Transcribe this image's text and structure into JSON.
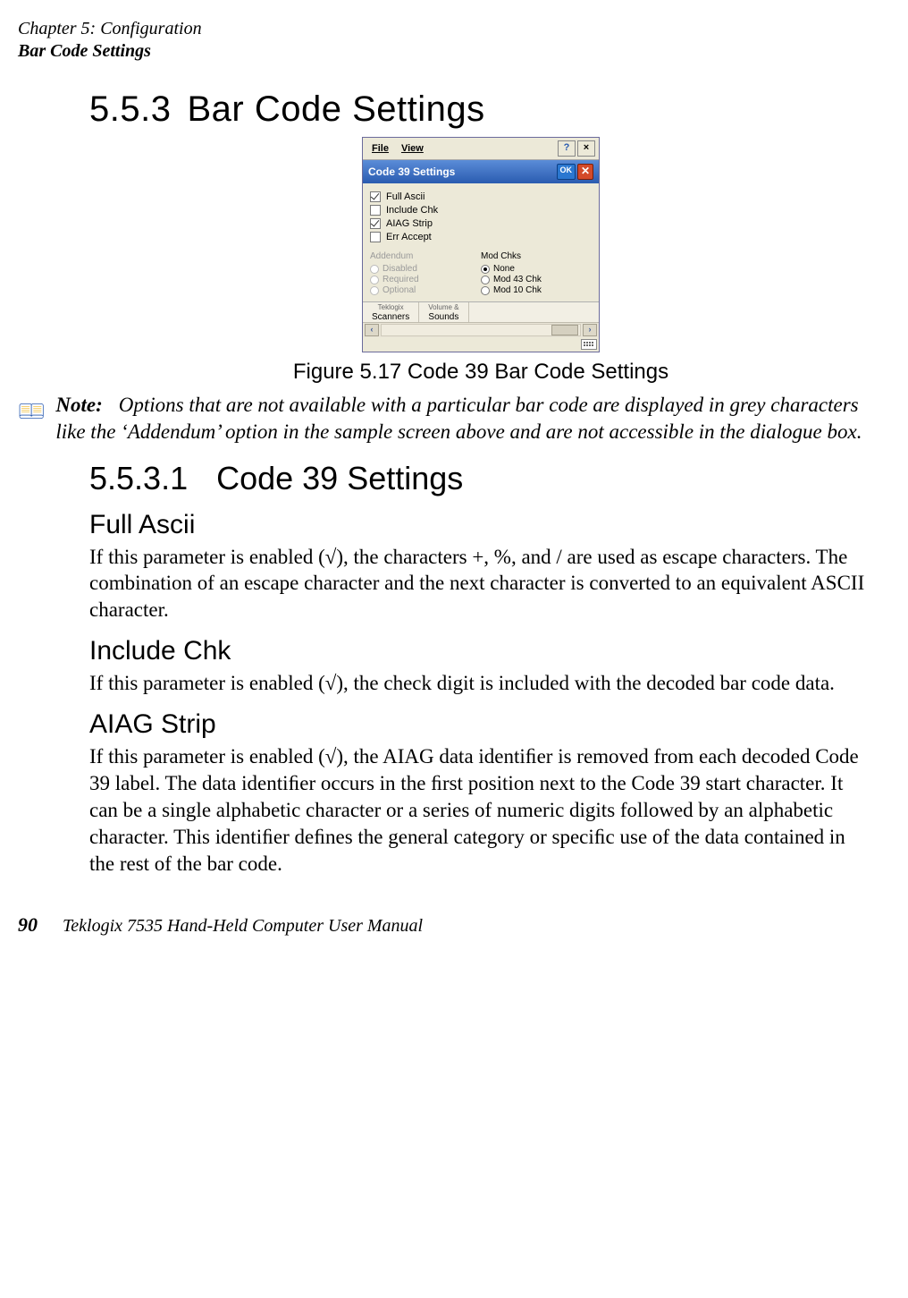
{
  "header": {
    "line1": "Chapter 5: Configuration",
    "line2": "Bar Code Settings"
  },
  "section": {
    "number": "5.5.3",
    "title": "Bar Code Settings"
  },
  "screenshot": {
    "menubar": {
      "file": "File",
      "view": "View",
      "help": "?",
      "close": "×"
    },
    "titlebar": {
      "title": "Code 39 Settings",
      "ok": "OK"
    },
    "checks": [
      {
        "label": "Full Ascii",
        "checked": true
      },
      {
        "label": "Include Chk",
        "checked": false
      },
      {
        "label": "AIAG Strip",
        "checked": true
      },
      {
        "label": "Err Accept",
        "checked": false
      }
    ],
    "addendum": {
      "title": "Addendum",
      "opts": [
        "Disabled",
        "Required",
        "Optional"
      ]
    },
    "modchks": {
      "title": "Mod Chks",
      "opts": [
        {
          "label": "None",
          "selected": true
        },
        {
          "label": "Mod 43 Chk",
          "selected": false
        },
        {
          "label": "Mod 10 Chk",
          "selected": false
        }
      ]
    },
    "tabs": [
      {
        "tiny": "Teklogix",
        "label": "Scanners"
      },
      {
        "tiny": "Volume &",
        "label": "Sounds"
      }
    ]
  },
  "figure": {
    "caption": "Figure 5.17 Code 39 Bar Code Settings"
  },
  "note": {
    "label": "Note:",
    "text": "Options that are not available with a particular bar code are displayed in grey characters like the ‘Addendum’ option in the sample screen above and are not accessible in the dialogue box."
  },
  "subsection": {
    "number": "5.5.3.1",
    "title": "Code 39 Settings"
  },
  "full_ascii": {
    "heading": "Full Ascii",
    "body": "If this parameter is enabled (√), the characters +, %, and / are used as escape characters. The combination of an escape character and the next character is converted to an equivalent ASCII character."
  },
  "include_chk": {
    "heading": "Include Chk",
    "body": "If this parameter is enabled (√), the check digit is included with the decoded bar code data."
  },
  "aiag_strip": {
    "heading": "AIAG Strip",
    "body": "If this parameter is enabled (√), the AIAG data identiﬁer is removed from each decoded Code 39 label. The data identiﬁer occurs in the ﬁrst position next to the Code 39 start character. It can be a single alphabetic character or a series of numeric digits followed by an alphabetic character. This identiﬁer deﬁnes the general category or speciﬁc use of the data contained in the rest of the bar code."
  },
  "footer": {
    "page": "90",
    "text": "Teklogix 7535 Hand-Held Computer User Manual"
  }
}
